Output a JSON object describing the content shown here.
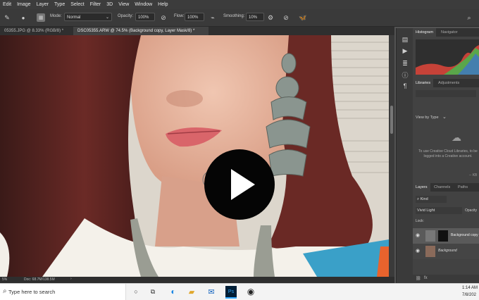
{
  "menu": [
    "Edit",
    "Image",
    "Layer",
    "Type",
    "Select",
    "Filter",
    "3D",
    "View",
    "Window",
    "Help"
  ],
  "options": {
    "mode_label": "Mode:",
    "mode_value": "Normal",
    "opacity_label": "Opacity:",
    "opacity_value": "100%",
    "flow_label": "Flow:",
    "flow_value": "100%",
    "smoothing_label": "Smoothing:",
    "smoothing_value": "10%"
  },
  "doc_tabs": [
    {
      "label": "05355.JPG @ 8.33% (RGB/8) *"
    },
    {
      "label": "DSC05355.ARW @ 74.5% (Background copy, Layer Mask/8) *"
    }
  ],
  "status": {
    "zoom": "5%",
    "doc": "Doc: 68.7M/138.5M"
  },
  "panels": {
    "top_tabs": [
      "Histogram",
      "Navigator"
    ],
    "lib_tabs": [
      "Libraries",
      "Adjustments"
    ],
    "view_by": "View by Type",
    "cc_message": "To use Creative Cloud Libraries, to be logged into a Creative account.",
    "kb": "-- KB",
    "layer_tabs": [
      "Layers",
      "Channels",
      "Paths"
    ],
    "kind": "Kind",
    "blend": "Vivid Light",
    "opacity_short": "Opacity",
    "lock": "Lock:",
    "layers": [
      "Background copy",
      "Background"
    ]
  },
  "taskbar": {
    "search_placeholder": "Type here to search",
    "time": "1:14 AM",
    "date": "7/8/202"
  },
  "colors": {
    "accent": "#1473e6",
    "bg": "#535353",
    "histogram_red": "#e0453a",
    "histogram_green": "#3fbf4f"
  }
}
